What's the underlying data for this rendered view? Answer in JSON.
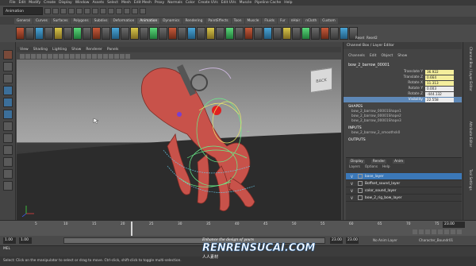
{
  "menubar": {
    "items": [
      "File",
      "Edit",
      "Modify",
      "Create",
      "Display",
      "Window",
      "Assets",
      "Select",
      "Mesh",
      "Edit Mesh",
      "Proxy",
      "Normals",
      "Color",
      "Create UVs",
      "Edit UVs",
      "Muscle",
      "Pipeline Cache",
      "Help"
    ]
  },
  "statusline": {
    "mode": "Animation"
  },
  "shelf": {
    "tabs": [
      "General",
      "Curves",
      "Surfaces",
      "Polygons",
      "Subdivs",
      "Deformation",
      "Animation",
      "Dynamics",
      "Rendering",
      "PaintEffects",
      "Toon",
      "Muscle",
      "Fluids",
      "Fur",
      "nHair",
      "nCloth",
      "Custom"
    ],
    "active_tab": "Animation",
    "labels": [
      "Reset",
      "Reset2"
    ]
  },
  "viewport": {
    "menu": [
      "View",
      "Shading",
      "Lighting",
      "Show",
      "Renderer",
      "Panels"
    ],
    "viewcube_label": "BACK"
  },
  "channel_box": {
    "tabs": [
      "Channel Box / Layer Editor"
    ],
    "menu": [
      "Channels",
      "Edit",
      "Object",
      "Show"
    ],
    "object_name": "bow_2_barrow_00001",
    "attributes": [
      {
        "key": "Translate Y",
        "value": "36.922"
      },
      {
        "key": "Translate Z",
        "value": "0.664"
      },
      {
        "key": "Rotate X",
        "value": "11.313"
      },
      {
        "key": "Rotate Y",
        "value": "0.003"
      },
      {
        "key": "Rotate Z",
        "value": "-444.132"
      },
      {
        "key": "Visibility",
        "value": "22.558"
      }
    ],
    "shapes_label": "SHAPES",
    "shapes": [
      "bow_2_barrow_00001Shape1",
      "bow_2_barrow_00001Shape2",
      "bow_2_barrow_00001Shape3"
    ],
    "inputs_label": "INPUTS",
    "inputs": [
      "bow_2_barrow_2_smoothsk0"
    ],
    "outputs_label": "OUTPUTS"
  },
  "layer_editor": {
    "tabs": [
      "Display",
      "Render",
      "Anim"
    ],
    "menu": [
      "Layers",
      "Options",
      "Help"
    ],
    "rows": [
      {
        "vis": "V",
        "name": "base_layer",
        "selected": true
      },
      {
        "vis": "V",
        "name": "Boffset_sound_layer",
        "selected": false
      },
      {
        "vis": "V",
        "name": "color_sound_layer",
        "selected": false
      },
      {
        "vis": "V",
        "name": "bow_2_rig_bow_layer",
        "selected": false
      }
    ]
  },
  "attribute_tabs": [
    "Channel Box / Layer Editor",
    "Attribute Editor",
    "Tool Settings"
  ],
  "timeline": {
    "ticks": [
      "5",
      "10",
      "15",
      "20",
      "25",
      "30",
      "35",
      "40",
      "45",
      "50",
      "55",
      "60",
      "65",
      "70",
      "75"
    ],
    "current_frame": "23.00",
    "current_fraction": 0.29
  },
  "range": {
    "start": "1.00",
    "inner_start": "1.00",
    "inner_end": "23.00",
    "end": "23.00",
    "anim_layer": "No Anim Layer",
    "char_set": "Character_Boundr01"
  },
  "command_line": {
    "lang": "MEL"
  },
  "help_line": "Select: Click on the manipulator to select or drag to move. Ctrl-click, shift-click to toggle multi-selection.",
  "watermark": {
    "line1": "Enhance the design of yours",
    "line2": "RENRENSUCAI.COM",
    "line3": "人人素材"
  },
  "colors": {
    "character": "#c8524a",
    "selected_layer": "#3b78b8",
    "highlight_attr": "#5e88b7",
    "attr_value": "#f4ee9c"
  }
}
